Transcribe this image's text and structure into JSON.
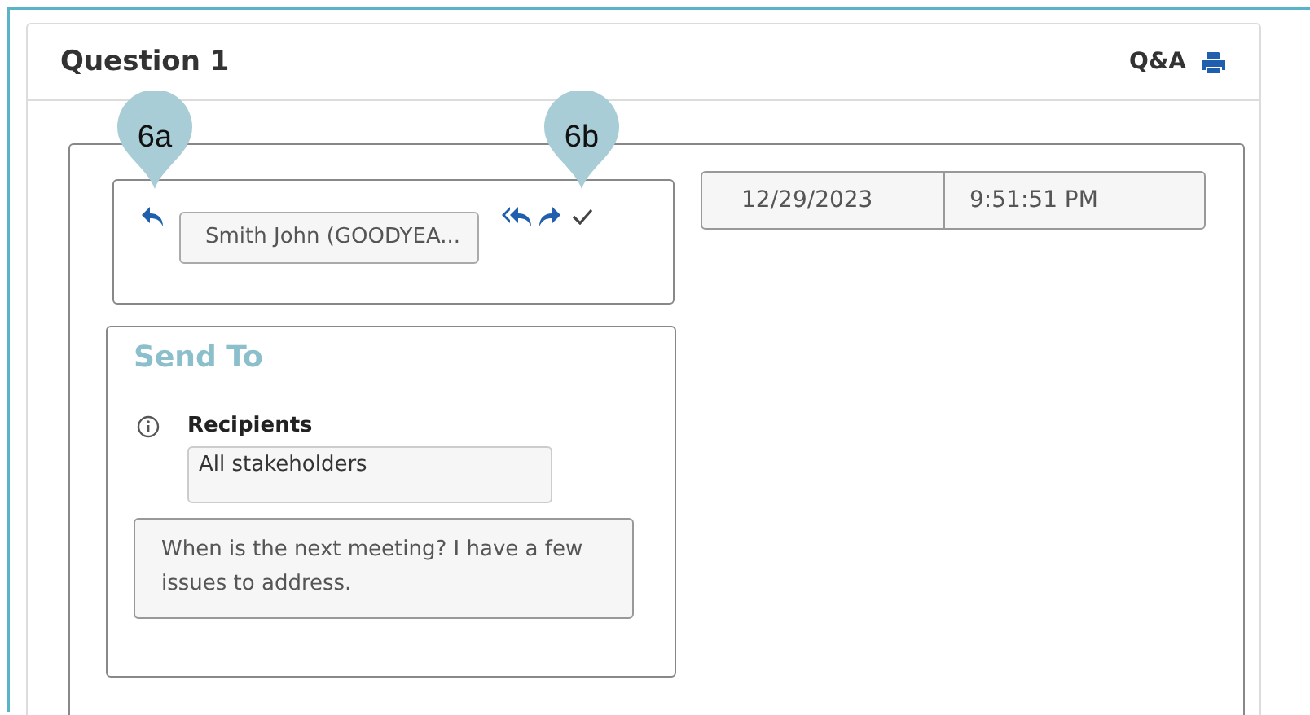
{
  "card": {
    "title": "Question 1",
    "link": "Q&A"
  },
  "sender": {
    "name": "Smith John (GOODYEA..."
  },
  "timestamp": {
    "date": "12/29/2023",
    "time": "9:51:51 PM"
  },
  "send_to": {
    "title": "Send To",
    "recipients_label": "Recipients",
    "recipients": "All stakeholders",
    "message": "When is the next meeting? I have a few issues to address."
  },
  "callouts": [
    {
      "label": "6a"
    },
    {
      "label": "6b"
    }
  ]
}
